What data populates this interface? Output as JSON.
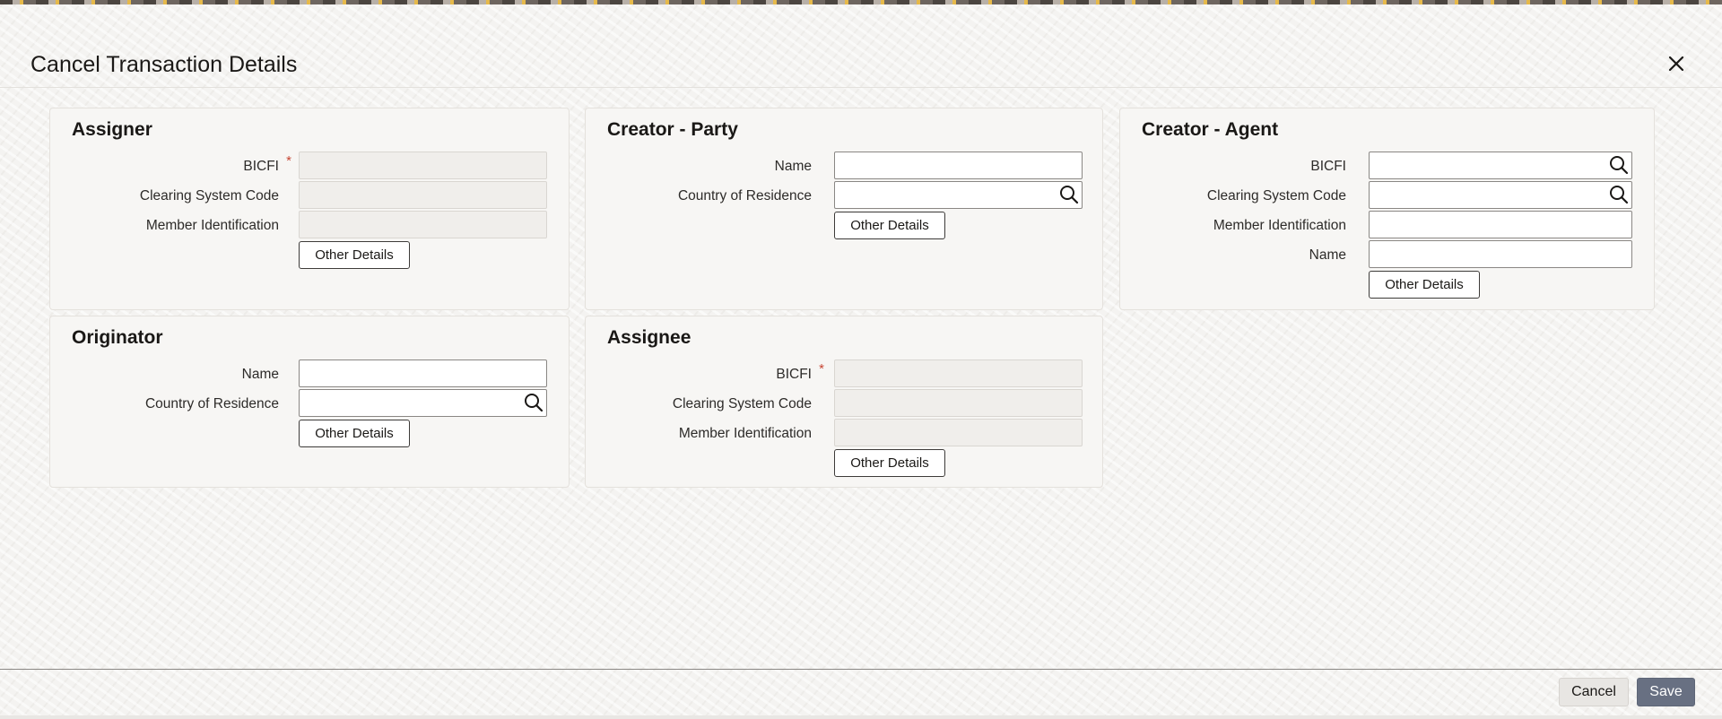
{
  "dialog": {
    "title": "Cancel Transaction Details"
  },
  "icons": {
    "close": "close-icon",
    "search": "search-icon"
  },
  "assigner": {
    "title": "Assigner",
    "bicfi_label": "BICFI",
    "bicfi_required": "*",
    "bicfi_value": "",
    "clearing_label": "Clearing System Code",
    "clearing_value": "",
    "member_label": "Member Identification",
    "member_value": "",
    "other_details": "Other Details"
  },
  "creator_party": {
    "title": "Creator - Party",
    "name_label": "Name",
    "name_value": "",
    "country_label": "Country of Residence",
    "country_value": "",
    "other_details": "Other Details"
  },
  "creator_agent": {
    "title": "Creator - Agent",
    "bicfi_label": "BICFI",
    "bicfi_value": "",
    "clearing_label": "Clearing System Code",
    "clearing_value": "",
    "member_label": "Member Identification",
    "member_value": "",
    "name_label": "Name",
    "name_value": "",
    "other_details": "Other Details"
  },
  "originator": {
    "title": "Originator",
    "name_label": "Name",
    "name_value": "",
    "country_label": "Country of Residence",
    "country_value": "",
    "other_details": "Other Details"
  },
  "assignee": {
    "title": "Assignee",
    "bicfi_label": "BICFI",
    "bicfi_required": "*",
    "bicfi_value": "",
    "clearing_label": "Clearing System Code",
    "clearing_value": "",
    "member_label": "Member Identification",
    "member_value": "",
    "other_details": "Other Details"
  },
  "footer": {
    "cancel_label": "Cancel",
    "save_label": "Save"
  },
  "colors": {
    "accent_save": "#687082",
    "required": "#c74634",
    "panel_bg": "#f7f6f4"
  }
}
